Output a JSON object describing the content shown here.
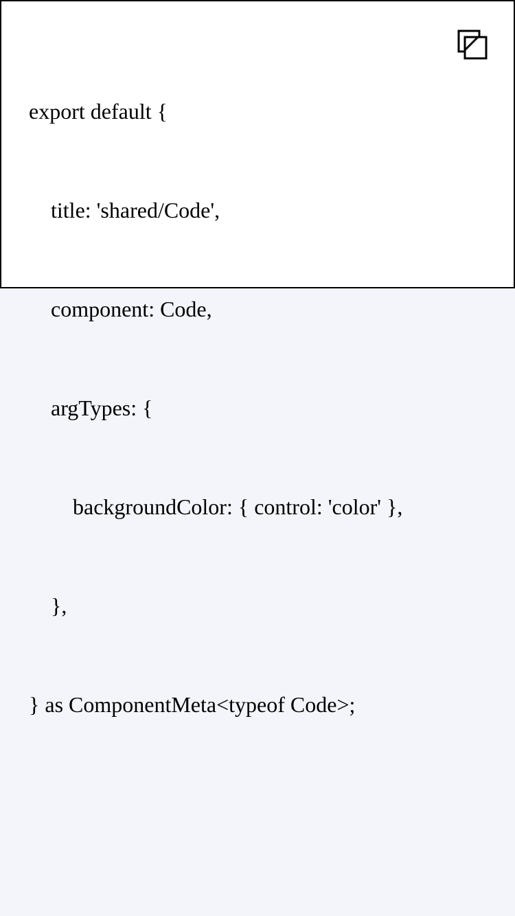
{
  "code_block": {
    "lines": [
      {
        "indent": 0,
        "text": "export default {"
      },
      {
        "indent": 1,
        "text": "title: 'shared/Code',"
      },
      {
        "indent": 1,
        "text": "component: Code,"
      },
      {
        "indent": 1,
        "text": "argTypes: {"
      },
      {
        "indent": 2,
        "text": "backgroundColor: { control: 'color' },"
      },
      {
        "indent": 1,
        "text": "},"
      },
      {
        "indent": 0,
        "text": "} as ComponentMeta<typeof Code>;"
      }
    ],
    "copy_icon": "copy-icon"
  },
  "colors": {
    "page_background": "#f3f5fa",
    "code_background": "#ffffff",
    "border": "#000000",
    "text": "#000000"
  }
}
